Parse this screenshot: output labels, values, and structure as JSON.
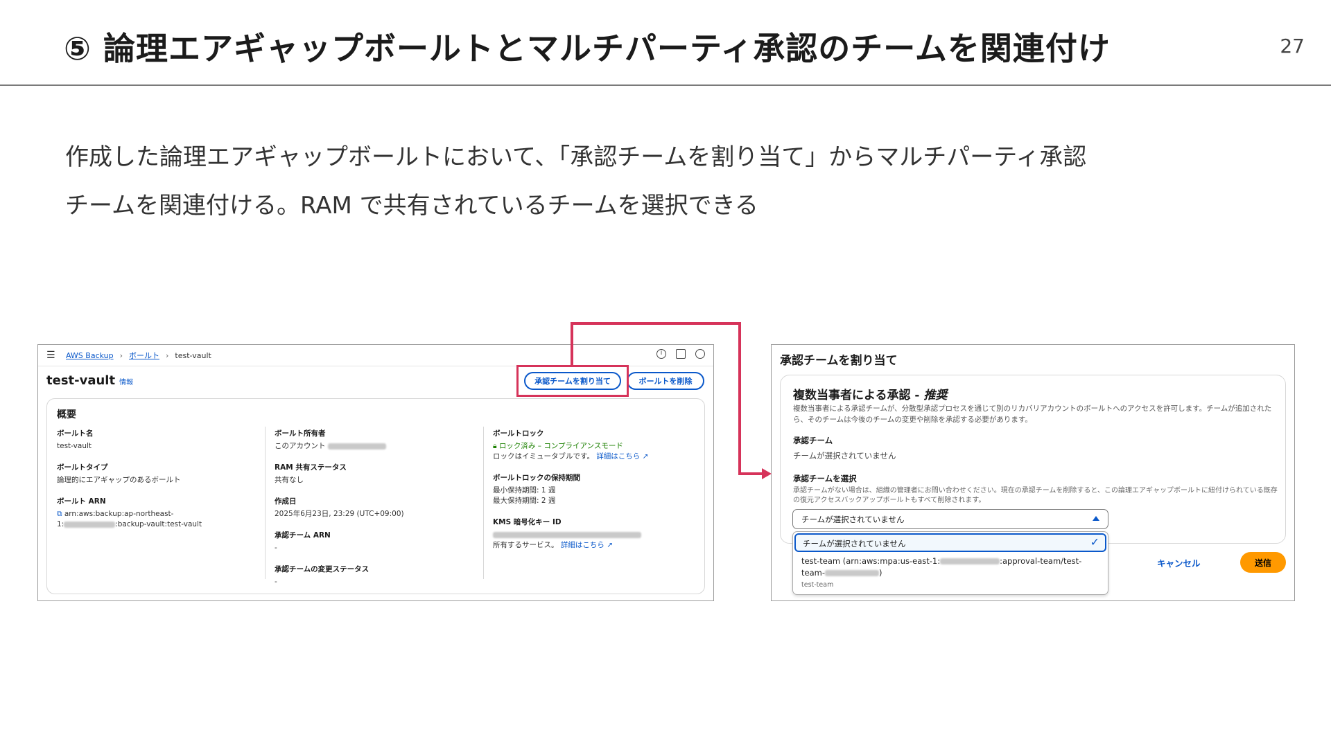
{
  "slide": {
    "title": "⑤ 論理エアギャップボールトとマルチパーティ承認のチームを関連付け",
    "page_number": "27",
    "body_line1": "作成した論理エアギャップボールトにおいて、「承認チームを割り当て」からマルチパーティ承認",
    "body_line2": "チームを関連付ける。RAM で共有されているチームを選択できる",
    "highlight_color": "#d6335a"
  },
  "vault_console": {
    "breadcrumb": [
      "AWS Backup",
      "ボールト",
      "test-vault"
    ],
    "vault_name": "test-vault",
    "info_label": "情報",
    "buttons": {
      "assign_team": "承認チームを割り当て",
      "delete_vault": "ボールトを削除"
    },
    "overview_heading": "概要",
    "col1": {
      "vault_name_label": "ボールト名",
      "vault_name_value": "test-vault",
      "vault_type_label": "ボールトタイプ",
      "vault_type_value": "論理的にエアギャップのあるボールト",
      "arn_label": "ボールト ARN",
      "arn_line1": "arn:aws:backup:ap-northeast-",
      "arn_line2_prefix": "1:",
      "arn_line2_suffix": ":backup-vault:test-vault"
    },
    "col2": {
      "owner_label": "ボールト所有者",
      "owner_value": "このアカウント",
      "ram_label": "RAM 共有ステータス",
      "ram_value": "共有なし",
      "created_label": "作成日",
      "created_value": "2025年6月23日, 23:29 (UTC+09:00)",
      "team_arn_label": "承認チーム ARN",
      "team_arn_value": "-",
      "team_change_label": "承認チームの変更ステータス",
      "team_change_value": "-"
    },
    "col3": {
      "lock_label": "ボールトロック",
      "lock_status": "ロック済み – コンプライアンスモード",
      "lock_note": "ロックはイミュータブルです。",
      "lock_more": "詳細はこちら",
      "retention_label": "ボールトロックの保持期間",
      "retention_min": "最小保持期間: 1 週",
      "retention_max": "最大保持期間: 2 週",
      "kms_label": "KMS 暗号化キー ID",
      "kms_note": "所有するサービス。",
      "kms_more": "詳細はこちら"
    }
  },
  "assign_modal": {
    "title": "承認チームを割り当て",
    "section_heading": "複数当事者による承認 - ",
    "section_heading_em": "推奨",
    "description": "複数当事者による承認チームが、分散型承認プロセスを通じて別のリカバリアカウントのボールトへのアクセスを許可します。チームが追加されたら、そのチームは今後のチームの変更や削除を承認する必要があります。",
    "team_label": "承認チーム",
    "team_value": "チームが選択されていません",
    "select_label": "承認チームを選択",
    "select_description": "承認チームがない場合は、組織の管理者にお問い合わせください。現在の承認チームを削除すると、この論理エアギャップボールトに紐付けられている既存の復元アクセスバックアップボールトもすべて削除されます。",
    "select_value": "チームが選択されていません",
    "options": [
      {
        "label": "チームが選択されていません",
        "selected": true
      },
      {
        "label_prefix": "test-team (arn:aws:mpa:us-east-1:",
        "label_suffix": ":approval-team/test-",
        "label_line2_prefix": "team-",
        "label_line2_suffix": ")",
        "sublabel": "test-team",
        "selected": false
      }
    ],
    "cancel": "キャンセル",
    "submit": "送信",
    "accent_color": "#0a58ca",
    "submit_color": "#ff9900"
  }
}
